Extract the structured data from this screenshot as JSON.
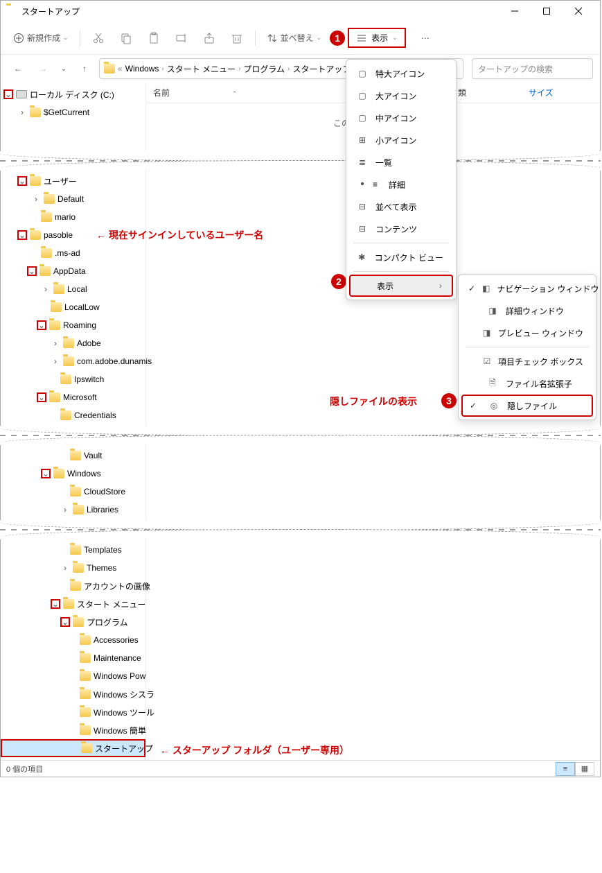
{
  "window": {
    "title": "スタートアップ",
    "btn_min": "—",
    "btn_max": "☐",
    "btn_close": "✕"
  },
  "toolbar": {
    "new": "新規作成",
    "sort": "並べ替え",
    "view": "表示"
  },
  "breadcrumb": {
    "prefix": "«",
    "items": [
      "Windows",
      "スタート メニュー",
      "プログラム",
      "スタートアップ"
    ]
  },
  "search": {
    "placeholder": "タートアップの検索"
  },
  "columns": {
    "name": "名前",
    "type": "類",
    "size": "サイズ"
  },
  "empty": "この",
  "tree": {
    "disk": "ローカル ディスク (C:)",
    "getcurrent": "$GetCurrent",
    "users": "ユーザー",
    "default": "Default",
    "mario": "mario",
    "pasoble": "pasoble",
    "msad": ".ms-ad",
    "appdata": "AppData",
    "local": "Local",
    "locallow": "LocalLow",
    "roaming": "Roaming",
    "adobe": "Adobe",
    "dunamis": "com.adobe.dunamis",
    "ipswitch": "Ipswitch",
    "microsoft": "Microsoft",
    "credentials": "Credentials",
    "vault": "Vault",
    "windows": "Windows",
    "cloudstore": "CloudStore",
    "libraries": "Libraries",
    "templates": "Templates",
    "themes": "Themes",
    "account_pics": "アカウントの画像",
    "startmenu": "スタート メニュー",
    "programs": "プログラム",
    "accessories": "Accessories",
    "maintenance": "Maintenance",
    "winpow": "Windows Pow",
    "winsys": "Windows シスラ",
    "wintool": "Windows ツール",
    "winkan": "Windows 簡単",
    "startup": "スタートアップ"
  },
  "annot": {
    "current_user": "← 現在サインインしているユーザー名",
    "hidden_files": "隠しファイルの表示",
    "startup_folder": "←  スターアップ フォルダ（ユーザー専用）"
  },
  "menu1": {
    "xl": "特大アイコン",
    "lg": "大アイコン",
    "md": "中アイコン",
    "sm": "小アイコン",
    "list": "一覧",
    "detail": "詳細",
    "tile": "並べて表示",
    "content": "コンテンツ",
    "compact": "コンパクト ビュー",
    "show": "表示"
  },
  "menu2": {
    "navpane": "ナビゲーション ウィンドウ",
    "detailpane": "詳細ウィンドウ",
    "preview": "プレビュー ウィンドウ",
    "checkboxes": "項目チェック ボックス",
    "ext": "ファイル名拡張子",
    "hidden": "隠しファイル"
  },
  "badges": {
    "b1": "1",
    "b2": "2",
    "b3": "3"
  },
  "status": {
    "items": "0 個の項目"
  }
}
